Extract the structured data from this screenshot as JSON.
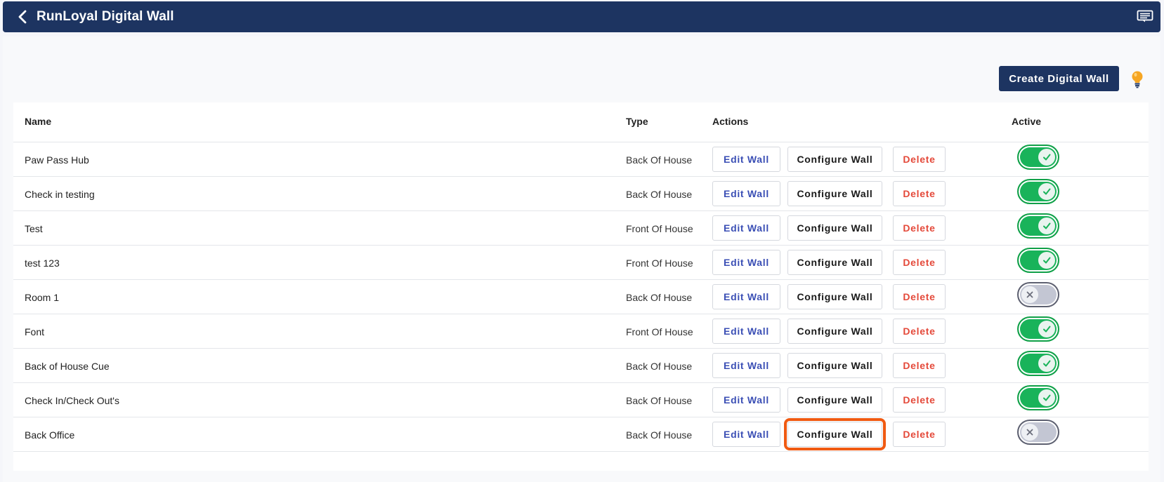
{
  "header": {
    "title": "RunLoyal Digital Wall",
    "back_icon": "chevron-left-icon",
    "menu_icon": "chat-menu-icon"
  },
  "toolbar": {
    "create_label": "Create Digital Wall",
    "help_icon": "lightbulb-icon"
  },
  "table": {
    "columns": {
      "name": "Name",
      "type": "Type",
      "actions": "Actions",
      "active": "Active"
    },
    "action_labels": {
      "edit": "Edit Wall",
      "configure": "Configure Wall",
      "delete": "Delete"
    },
    "rows": [
      {
        "name": "Paw Pass Hub",
        "type": "Back Of House",
        "active": true
      },
      {
        "name": "Check in testing",
        "type": "Back Of House",
        "active": true
      },
      {
        "name": "Test",
        "type": "Front Of House",
        "active": true
      },
      {
        "name": "test 123",
        "type": "Front Of House",
        "active": true
      },
      {
        "name": "Room 1",
        "type": "Back Of House",
        "active": false
      },
      {
        "name": "Font",
        "type": "Front Of House",
        "active": true
      },
      {
        "name": "Back of House Cue",
        "type": "Back Of House",
        "active": true
      },
      {
        "name": "Check In/Check Out's",
        "type": "Back Of House",
        "active": true
      },
      {
        "name": "Back Office",
        "type": "Back Of House",
        "active": false
      }
    ]
  },
  "colors": {
    "header_bg": "#1d3461",
    "toggle_on": "#19b35a",
    "toggle_off": "#c3c6d3",
    "edit_text": "#3b4fb5",
    "delete_text": "#e4493a",
    "highlight": "#f05a12"
  }
}
